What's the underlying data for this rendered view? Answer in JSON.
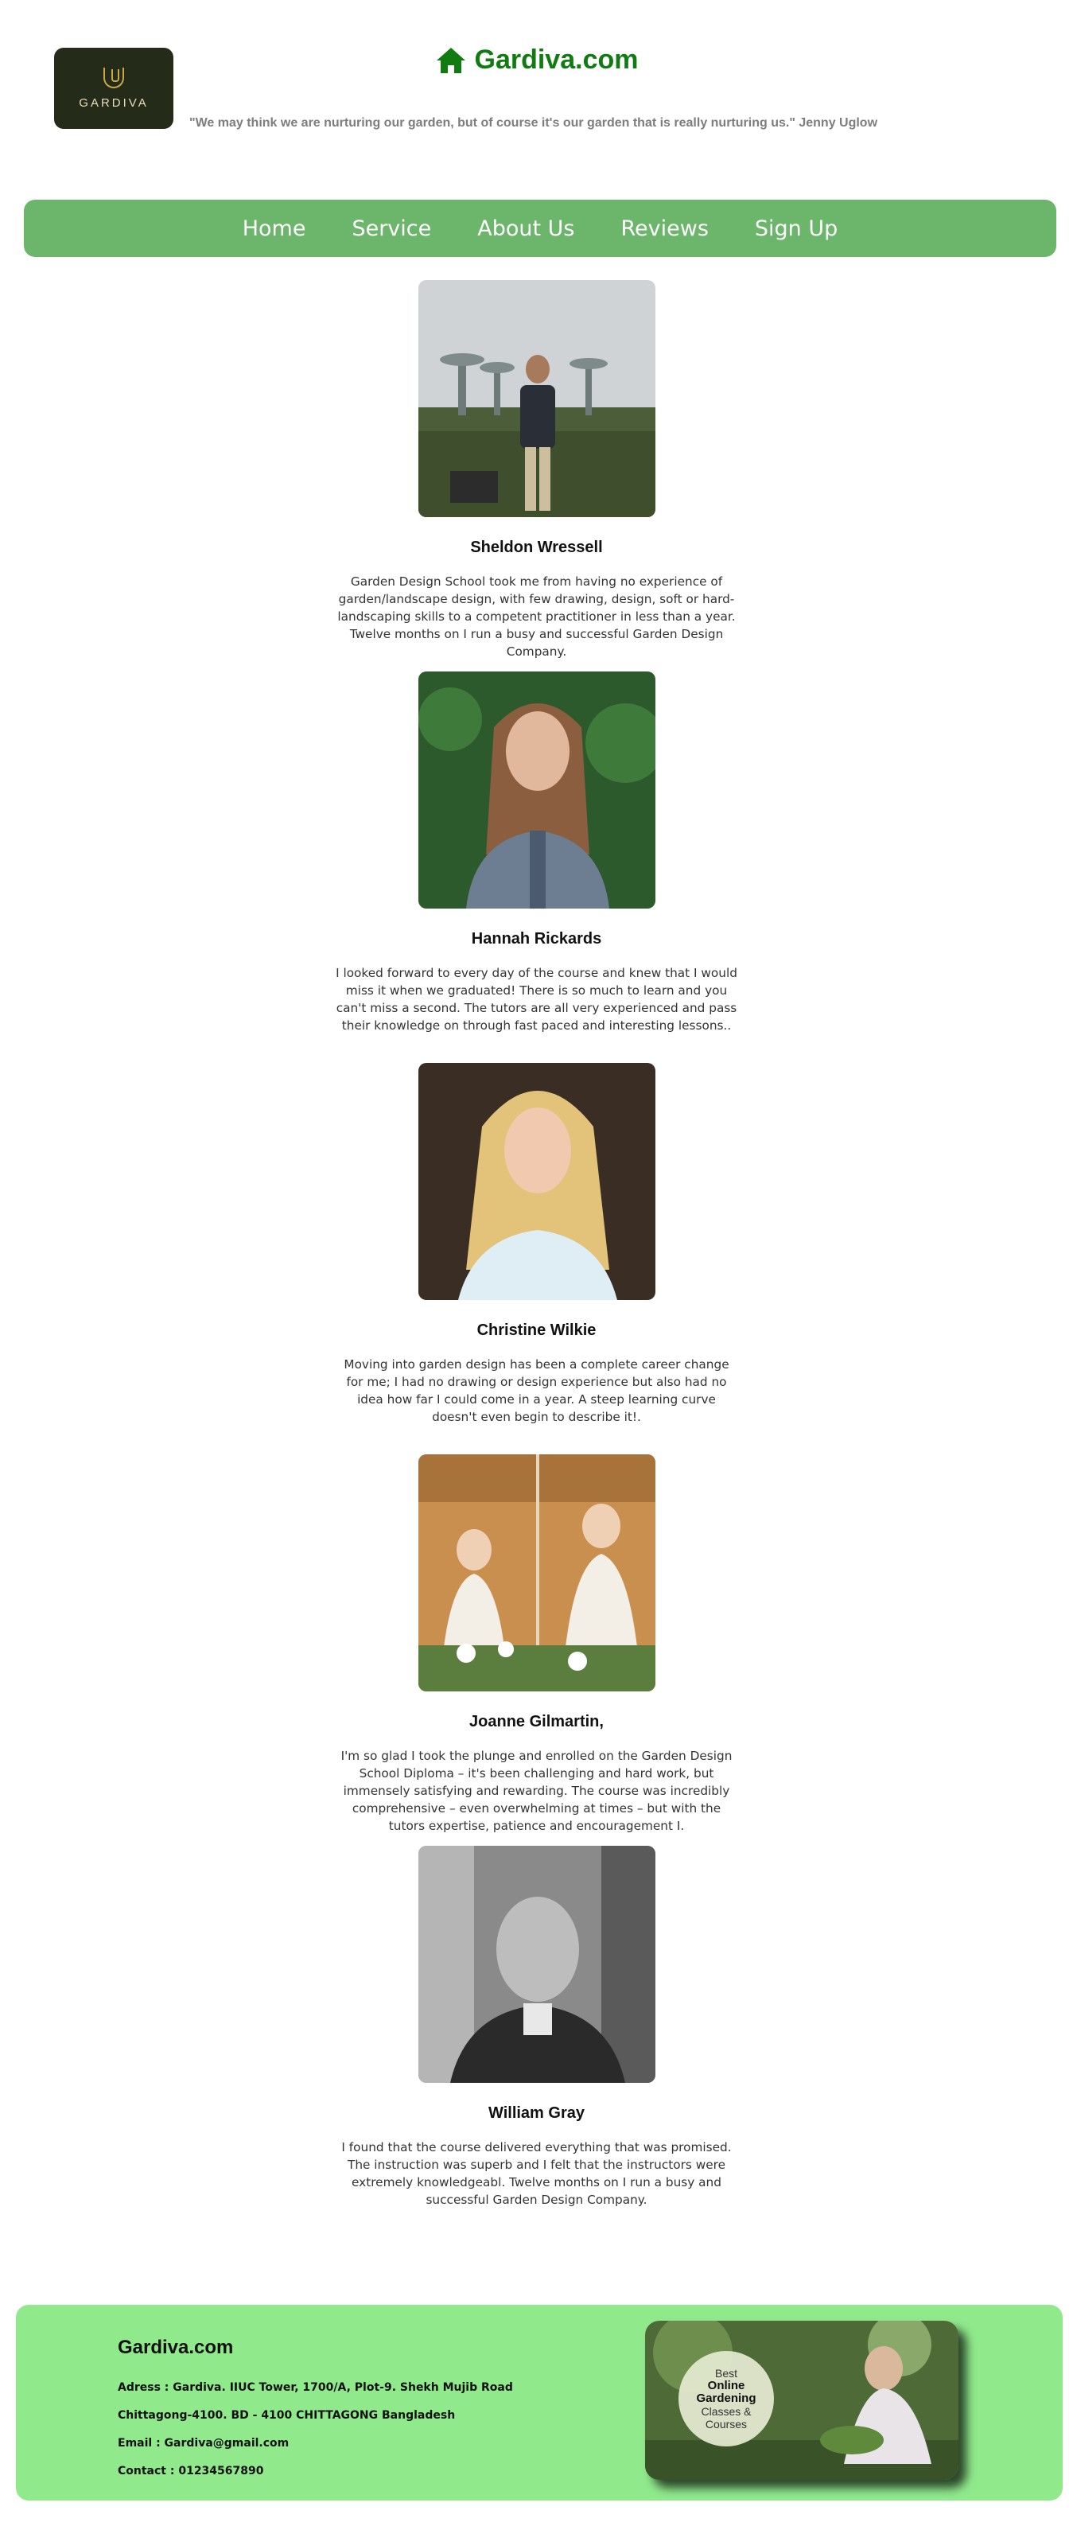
{
  "header": {
    "logo_text": "GARDIVA",
    "brand_title": "Gardiva.com",
    "quote": "\"We may think we are nurturing our garden, but of course it's our garden that is really nurturing us.\" Jenny Uglow"
  },
  "nav": {
    "items": [
      {
        "label": "Home"
      },
      {
        "label": "Service"
      },
      {
        "label": "About Us"
      },
      {
        "label": "Reviews"
      },
      {
        "label": "Sign Up"
      }
    ]
  },
  "reviews": [
    {
      "name": "Sheldon Wressell",
      "text": "Garden Design School took me from having no experience of garden/landscape design, with few drawing, design, soft or hard-landscaping skills to a competent practitioner in less than a year. Twelve months on I run a busy and successful Garden Design Company."
    },
    {
      "name": "Hannah Rickards",
      "text": "I looked forward to every day of the course and knew that I would miss it when we graduated! There is so much to learn and you can't miss a second. The tutors are all very experienced and pass their knowledge on through fast paced and interesting lessons.."
    },
    {
      "name": "Christine Wilkie",
      "text": "Moving into garden design has been a complete career change for me; I had no drawing or design experience but also had no idea how far I could come in a year. A steep learning curve doesn't even begin to describe it!."
    },
    {
      "name": "Joanne Gilmartin,",
      "text": "I'm so glad I took the plunge and enrolled on the Garden Design School Diploma – it's been challenging and hard work, but immensely satisfying and rewarding. The course was incredibly comprehensive – even overwhelming at times – but with the tutors expertise, patience and encouragement I."
    },
    {
      "name": "William Gray",
      "text": "I found that the course delivered everything that was promised. The instruction was superb and I felt that the instructors were extremely knowledgeabl. Twelve months on I run a busy and successful Garden Design Company."
    }
  ],
  "footer": {
    "title": "Gardiva.com",
    "address_line1": "Adress : Gardiva. IIUC Tower, 1700/A, Plot-9. Shekh Mujib Road",
    "address_line2": "Chittagong-4100. BD - 4100 CHITTAGONG Bangladesh",
    "email": "Email : Gardiva@gmail.com",
    "contact": "Contact : 01234567890",
    "ad": {
      "line1": "Best",
      "line2": "Online",
      "line3": "Gardening",
      "line4": "Classes &",
      "line5": "Courses"
    }
  },
  "colors": {
    "brand": "#107b10",
    "nav_bg": "#6cb66b",
    "footer_bg": "#90ea8c"
  }
}
